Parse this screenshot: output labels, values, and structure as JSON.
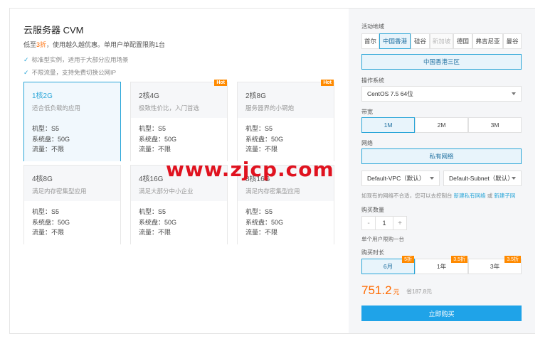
{
  "product": {
    "title": "云服务器 CVM",
    "promo_prefix": "低至",
    "promo_highlight": "3折",
    "promo_suffix": "，使用越久越优惠。单用户单配置限购1台",
    "features": [
      "标准型实例，适用于大部分应用场景",
      "不限流量，支持免费切换公网IP"
    ]
  },
  "cards": [
    {
      "name": "1核2G",
      "desc": "适合低负载的应用",
      "model": "机型：S5",
      "disk": "系统盘：50G",
      "traffic": "流量：不限",
      "hot": ""
    },
    {
      "name": "2核4G",
      "desc": "极致性价比，入门首选",
      "model": "机型：S5",
      "disk": "系统盘：50G",
      "traffic": "流量：不限",
      "hot": "Hot"
    },
    {
      "name": "2核8G",
      "desc": "服务器界的小钢炮",
      "model": "机型：S5",
      "disk": "系统盘：50G",
      "traffic": "流量：不限",
      "hot": "Hot"
    },
    {
      "name": "4核8G",
      "desc": "满足内存密集型应用",
      "model": "机型：S5",
      "disk": "系统盘：50G",
      "traffic": "流量：不限",
      "hot": ""
    },
    {
      "name": "4核16G",
      "desc": "满足大部分中小企业",
      "model": "机型：S5",
      "disk": "系统盘：50G",
      "traffic": "流量：不限",
      "hot": ""
    },
    {
      "name": "8核16G",
      "desc": "满足内存密集型应用",
      "model": "机型：S5",
      "disk": "系统盘：50G",
      "traffic": "流量：不限",
      "hot": ""
    }
  ],
  "region": {
    "label": "活动地域",
    "options": [
      "首尔",
      "中国香港",
      "硅谷",
      "新加坡",
      "德国",
      "弗吉尼亚",
      "曼谷"
    ],
    "zone": "中国香港三区"
  },
  "os": {
    "label": "操作系统",
    "value": "CentOS 7.5 64位"
  },
  "bandwidth": {
    "label": "带宽",
    "options": [
      "1M",
      "2M",
      "3M"
    ]
  },
  "network": {
    "label": "网络",
    "value": "私有网络",
    "vpc": "Default-VPC（默认）",
    "subnet": "Default-Subnet（默认）",
    "hint_prefix": "如现有的网络不合适，您可以去控制台",
    "hint_link1": "新建私有网络",
    "hint_mid": "或",
    "hint_link2": "新建子网"
  },
  "quantity": {
    "label": "购买数量",
    "minus": "-",
    "value": "1",
    "plus": "+",
    "note": "单个用户限购一台"
  },
  "duration": {
    "label": "购买时长",
    "options": [
      {
        "label": "6月",
        "tag": "5折"
      },
      {
        "label": "1年",
        "tag": "3.5折"
      },
      {
        "label": "3年",
        "tag": "3.5折"
      }
    ]
  },
  "price": {
    "value": "751.2",
    "unit": "元",
    "save": "省187.8元"
  },
  "buy_label": "立即购买",
  "watermark": "www.zjcp.com",
  "colors": {
    "accent": "#2ba6d8",
    "orange": "#ff6a00",
    "buy": "#1fa3e8"
  }
}
